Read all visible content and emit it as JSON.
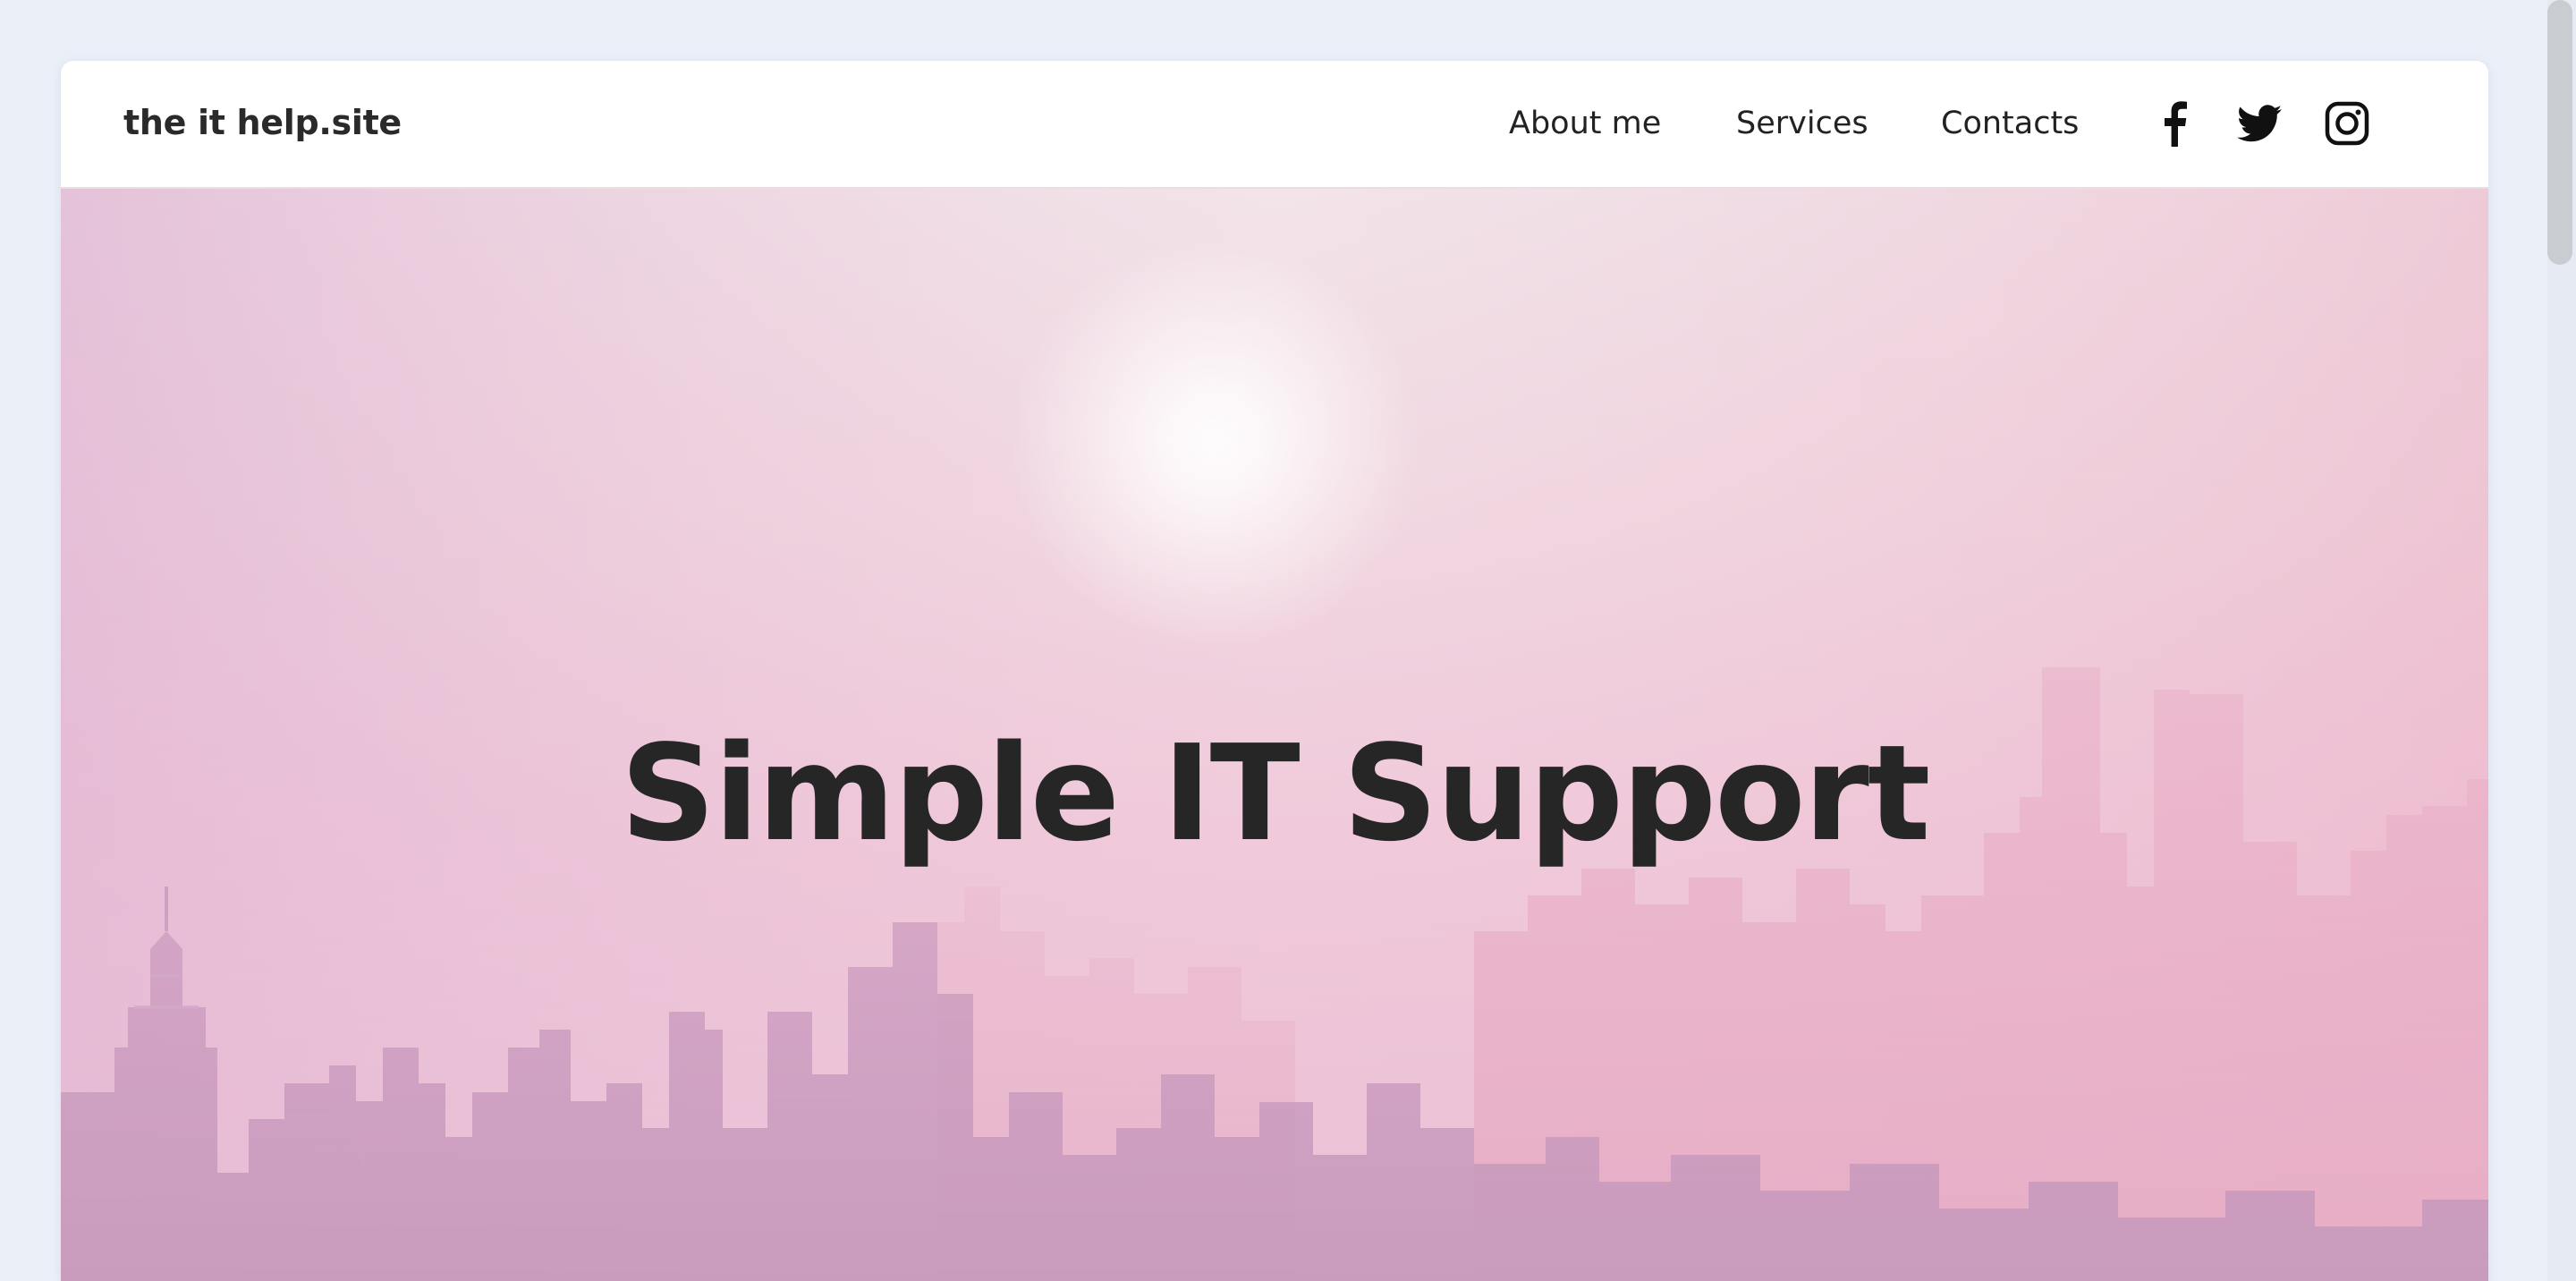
{
  "site": {
    "brand": "the it help.site"
  },
  "nav": {
    "links": [
      {
        "label": "About me"
      },
      {
        "label": "Services"
      },
      {
        "label": "Contacts"
      }
    ],
    "social_icons": [
      "facebook-icon",
      "twitter-icon",
      "instagram-icon"
    ]
  },
  "hero": {
    "title": "Simple IT Support",
    "background": "pink hazy city skyline with sun",
    "title_color": "#262626"
  },
  "colors": {
    "page_background": "#eaeff8",
    "navbar_background": "#ffffff",
    "text": "#222222",
    "hero_pink": "#efc6d8"
  }
}
